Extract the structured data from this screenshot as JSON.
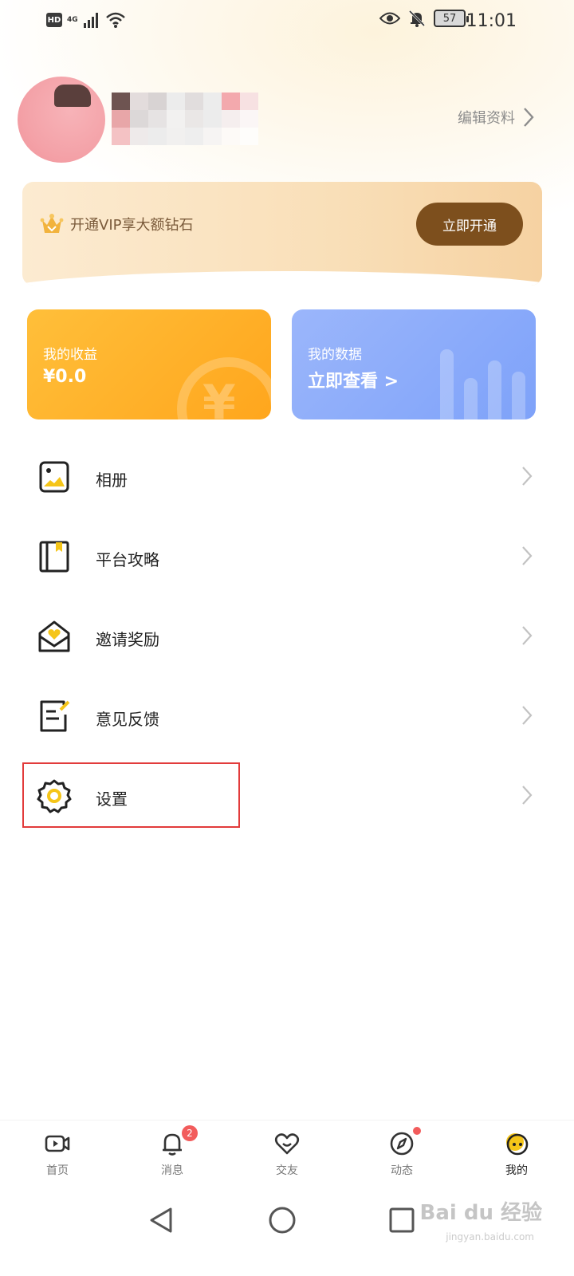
{
  "status_bar": {
    "hd": "HD",
    "network": "4G",
    "battery": "57",
    "time": "11:01"
  },
  "profile": {
    "edit_label": "编辑资料"
  },
  "vip": {
    "text": "开通VIP享大额钻石",
    "button": "立即开通"
  },
  "cards": {
    "earnings": {
      "title": "我的收益",
      "value": "¥0.0"
    },
    "data": {
      "title": "我的数据",
      "value": "立即查看 >"
    }
  },
  "menu": [
    {
      "label": "相册",
      "icon": "album-icon"
    },
    {
      "label": "平台攻略",
      "icon": "guide-book-icon"
    },
    {
      "label": "邀请奖励",
      "icon": "invite-envelope-icon"
    },
    {
      "label": "意见反馈",
      "icon": "feedback-icon"
    },
    {
      "label": "设置",
      "icon": "gear-icon"
    }
  ],
  "tabs": [
    {
      "label": "首页",
      "icon": "video-icon"
    },
    {
      "label": "消息",
      "icon": "bell-icon",
      "badge": "2"
    },
    {
      "label": "交友",
      "icon": "heart-icon"
    },
    {
      "label": "动态",
      "icon": "compass-icon"
    },
    {
      "label": "我的",
      "icon": "profile-face-icon",
      "active": true
    }
  ],
  "watermark": {
    "brand": "Bai du 经验",
    "url": "jingyan.baidu.com"
  },
  "colors": {
    "accent_brown": "#7d4f1d",
    "earn_card": "#ffa61d",
    "data_card": "#7ea2f9",
    "badge_red": "#f25c5c",
    "highlight_red": "#e23b3b"
  }
}
